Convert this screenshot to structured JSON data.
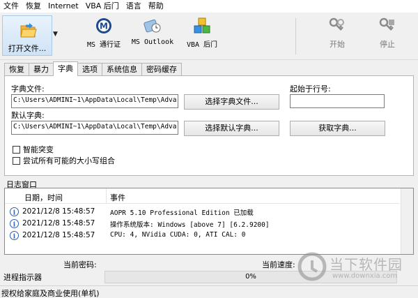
{
  "menu": [
    "文件",
    "恢复",
    "Internet",
    "VBA 后门",
    "语言",
    "帮助"
  ],
  "toolbar": {
    "open_label": "打开文件...",
    "ms_passport": "MS 通行证",
    "ms_outlook": "MS Outlook",
    "vba_backdoor": "VBA 后门",
    "start": "开始",
    "stop": "停止"
  },
  "tabs": [
    {
      "label": "恢复",
      "active": false
    },
    {
      "label": "暴力",
      "active": false
    },
    {
      "label": "字典",
      "active": true
    },
    {
      "label": "选项",
      "active": false
    },
    {
      "label": "系统信息",
      "active": false
    },
    {
      "label": "密码缓存",
      "active": false
    }
  ],
  "dictionary": {
    "dict_file_label": "字典文件:",
    "dict_file_value": "C:\\Users\\ADMINI~1\\AppData\\Local\\Temp\\Adva",
    "choose_dict_button": "选择字典文件...",
    "start_line_label": "起始于行号:",
    "start_line_value": "",
    "default_dict_label": "默认字典:",
    "default_dict_value": "C:\\Users\\ADMINI~1\\AppData\\Local\\Temp\\Adva",
    "choose_default_button": "选择默认字典...",
    "get_dict_button": "获取字典...",
    "smart_mutation": "智能突变",
    "try_case_combos": "尝试所有可能的大小写组合"
  },
  "log": {
    "title": "日志窗口",
    "col_datetime": "日期，时间",
    "col_event": "事件",
    "rows": [
      {
        "datetime": "2021/12/8 15:48:57",
        "event": "AOPR 5.10 Professional Edition 已加载"
      },
      {
        "datetime": "2021/12/8 15:48:57",
        "event": "操作系统版本: Windows [above 7] [6.2.9200]"
      },
      {
        "datetime": "2021/12/8 15:48:57",
        "event": "CPU: 4, NVidia CUDA: 0, ATI CAL: 0"
      }
    ]
  },
  "status": {
    "current_password_label": "当前密码:",
    "current_speed_label": "当前速度:",
    "progress_label": "进程指示器",
    "progress_percent": 0,
    "progress_text": "0%",
    "footer": "授权给家庭及商业使用(单机)"
  },
  "watermark": {
    "text": "当下软件园",
    "url": "www.downxia.com"
  },
  "colors": {
    "progress_fill": "#06b025",
    "selected_button_bg": "#cfe3f6"
  }
}
